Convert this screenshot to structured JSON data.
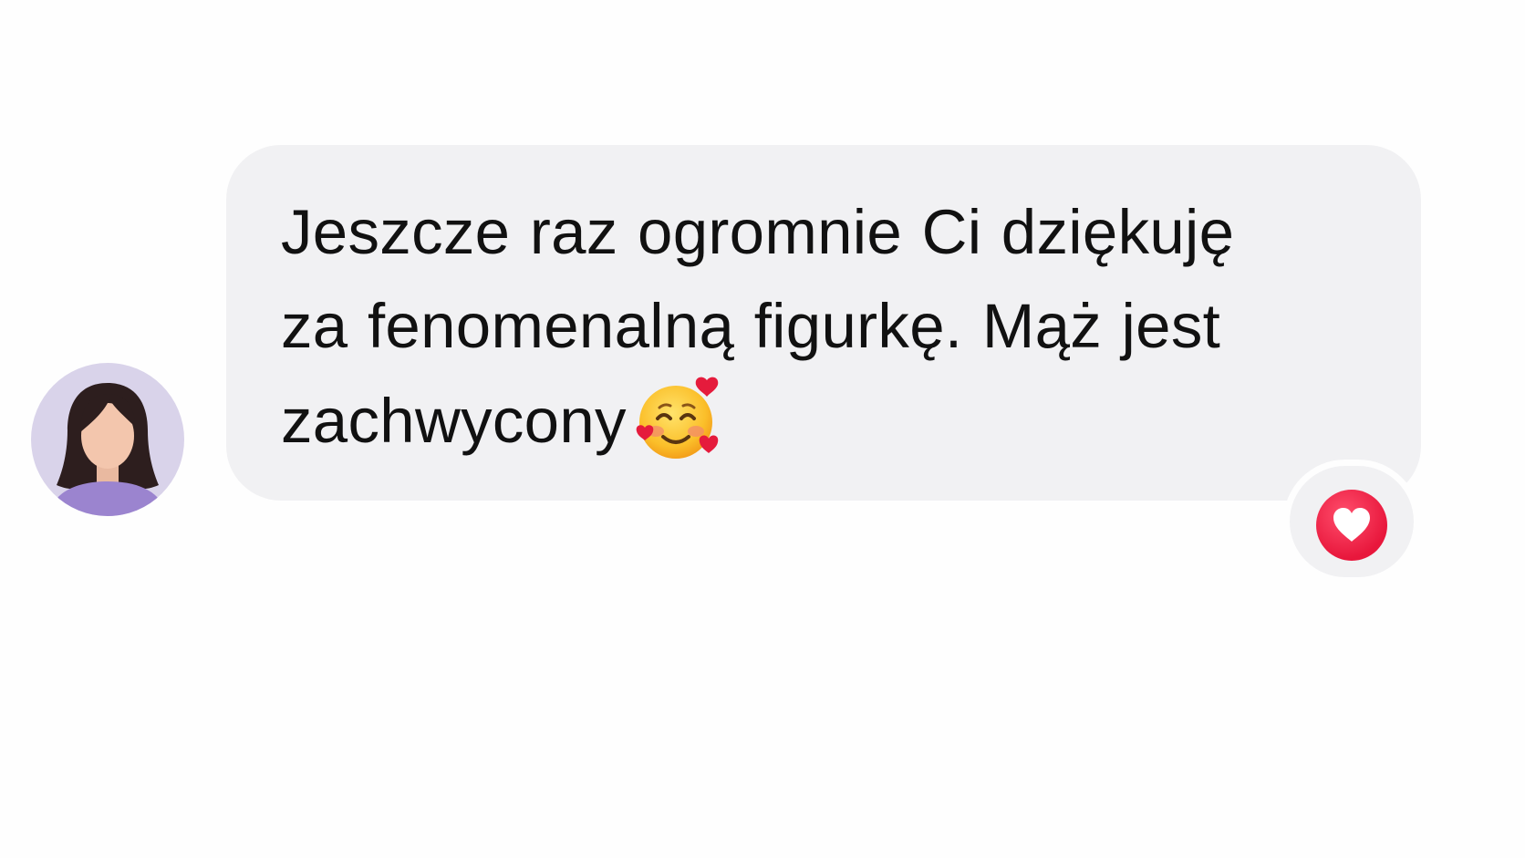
{
  "message": {
    "line1": "Jeszcze raz ogromnie Ci dziękuję",
    "line2": "za fenomenalną figurkę. Mąż jest",
    "line3": "zachwycony",
    "emoji": "smiling-face-with-hearts"
  },
  "reaction": {
    "icon": "heart-icon",
    "color": "#e8173c"
  },
  "avatar": {
    "icon": "woman-avatar-icon",
    "background": "#d9d3ea"
  },
  "colors": {
    "bubble": "#f1f1f3",
    "text": "#111111"
  }
}
